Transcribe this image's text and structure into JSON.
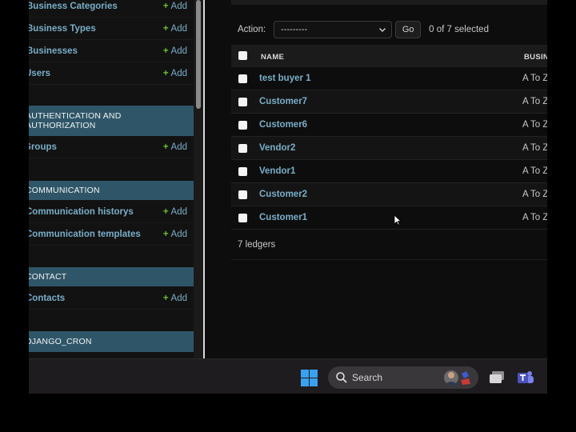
{
  "sidebar": {
    "add_label": "Add",
    "rows_top": [
      {
        "name": "Business Categories"
      },
      {
        "name": "Business Types"
      },
      {
        "name": "Businesses"
      },
      {
        "name": "Users"
      }
    ],
    "sections": [
      {
        "header": "AUTHENTICATION AND AUTHORIZATION",
        "rows": [
          {
            "name": "Groups"
          }
        ]
      },
      {
        "header": "COMMUNICATION",
        "rows": [
          {
            "name": "Communication historys"
          },
          {
            "name": "Communication templates"
          }
        ]
      },
      {
        "header": "CONTACT",
        "rows": [
          {
            "name": "Contacts"
          }
        ]
      },
      {
        "header": "DJANGO_CRON",
        "rows": []
      }
    ]
  },
  "actions": {
    "label": "Action:",
    "select_value": "---------",
    "go_label": "Go",
    "selected_text": "0 of 7 selected"
  },
  "table": {
    "columns": [
      "NAME",
      "BUSINE"
    ],
    "rows": [
      {
        "name": "test buyer 1",
        "business": "A To Z"
      },
      {
        "name": "Customer7",
        "business": "A To Z"
      },
      {
        "name": "Customer6",
        "business": "A To Z"
      },
      {
        "name": "Vendor2",
        "business": "A To Z"
      },
      {
        "name": "Vendor1",
        "business": "A To Z"
      },
      {
        "name": "Customer2",
        "business": "A To Z"
      },
      {
        "name": "Customer1",
        "business": "A To Z"
      }
    ],
    "count_text": "7 ledgers"
  },
  "taskbar": {
    "search_text": "Search",
    "icons": [
      "windows-start-icon",
      "search-icon",
      "task-view-icon",
      "teams-icon"
    ]
  },
  "colors": {
    "link": "#79aec8",
    "add_plus": "#70bf2b",
    "section_header": "#2f5668",
    "background": "#121212"
  }
}
